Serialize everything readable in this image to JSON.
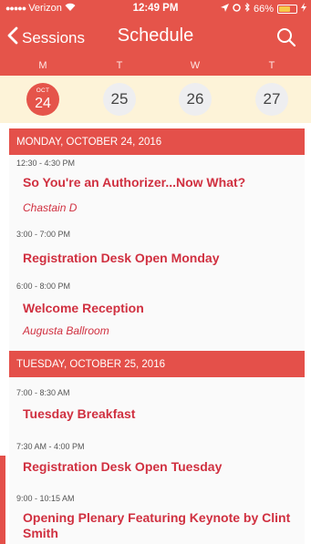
{
  "status_bar": {
    "carrier": "Verizon",
    "time": "12:49 PM",
    "battery_percent": "66%",
    "battery_level": 0.66
  },
  "nav": {
    "back_label": "Sessions",
    "title": "Schedule"
  },
  "weekdays": [
    "M",
    "T",
    "W",
    "T"
  ],
  "dates": [
    {
      "month": "OCT",
      "day": "24",
      "selected": true
    },
    {
      "month": "",
      "day": "25",
      "selected": false
    },
    {
      "month": "",
      "day": "26",
      "selected": false
    },
    {
      "month": "",
      "day": "27",
      "selected": false
    }
  ],
  "days": [
    {
      "header": "MONDAY, OCTOBER 24, 2016",
      "events": [
        {
          "time": "12:30 - 4:30 PM",
          "title": "So You're an Authorizer...Now What?",
          "location": "Chastain D"
        },
        {
          "time": "3:00 - 7:00 PM",
          "title": "Registration Desk Open Monday",
          "location": ""
        },
        {
          "time": "6:00 - 8:00 PM",
          "title": "Welcome Reception",
          "location": "Augusta Ballroom"
        }
      ]
    },
    {
      "header": "TUESDAY, OCTOBER 25, 2016",
      "events": [
        {
          "time": "7:00 - 8:30 AM",
          "title": "Tuesday Breakfast",
          "location": ""
        },
        {
          "time": "7:30 AM - 4:00 PM",
          "title": "Registration Desk Open Tuesday",
          "location": ""
        },
        {
          "time": "9:00 - 10:15 AM",
          "title": "Opening Plenary Featuring Keynote by Clint Smith",
          "location": ""
        }
      ]
    }
  ],
  "colors": {
    "accent": "#e5544a",
    "event_text": "#d03040",
    "date_bar": "#fdf3d8"
  }
}
